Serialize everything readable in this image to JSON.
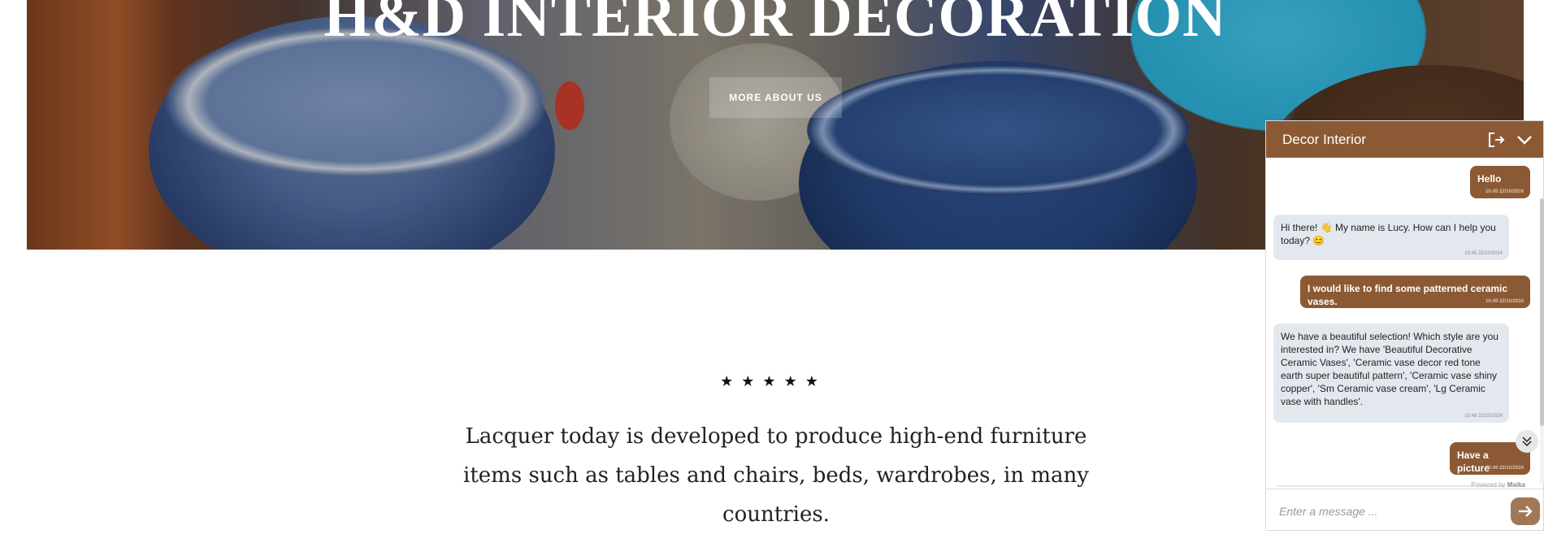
{
  "hero": {
    "title": "H&D INTERIOR DECORATION",
    "button_label": "MORE ABOUT US"
  },
  "testimonial": {
    "stars": "★★★★★",
    "rating": 5,
    "quote": "Lacquer today is developed to produce high-end furniture items such as tables and chairs, beds, wardrobes, in many countries."
  },
  "chat": {
    "title": "Decor Interior",
    "header_icons": [
      "exit-icon",
      "chevron-down-icon"
    ],
    "messages": [
      {
        "from": "user",
        "text": "Hello",
        "time": "10:45 22/10/2024"
      },
      {
        "from": "bot",
        "text": "Hi there! 👋 My name is Lucy. How can I help you today? 😊",
        "time": "10:45 22/10/2024"
      },
      {
        "from": "user",
        "text": "I would like to find some patterned ceramic vases.",
        "time": "10:49 22/10/2024"
      },
      {
        "from": "bot",
        "text": "We have a beautiful selection! Which style are you interested in? We have 'Beautiful Decorative Ceramic Vases', 'Ceramic vase decor red tone earth super beautiful pattern', 'Ceramic vase shiny copper', 'Sm Ceramic vase cream', 'Lg Ceramic vase with handles'.",
        "time": "10:49 22/10/2024"
      },
      {
        "from": "user",
        "text": "Have a picture",
        "time": "10:49 22/10/2024"
      }
    ],
    "powered_prefix": "Powered by",
    "powered_brand": "Maika",
    "input_placeholder": "Enter a message ...",
    "colors": {
      "accent": "#8b5a35",
      "bot_bubble": "#e3e8ef"
    }
  }
}
